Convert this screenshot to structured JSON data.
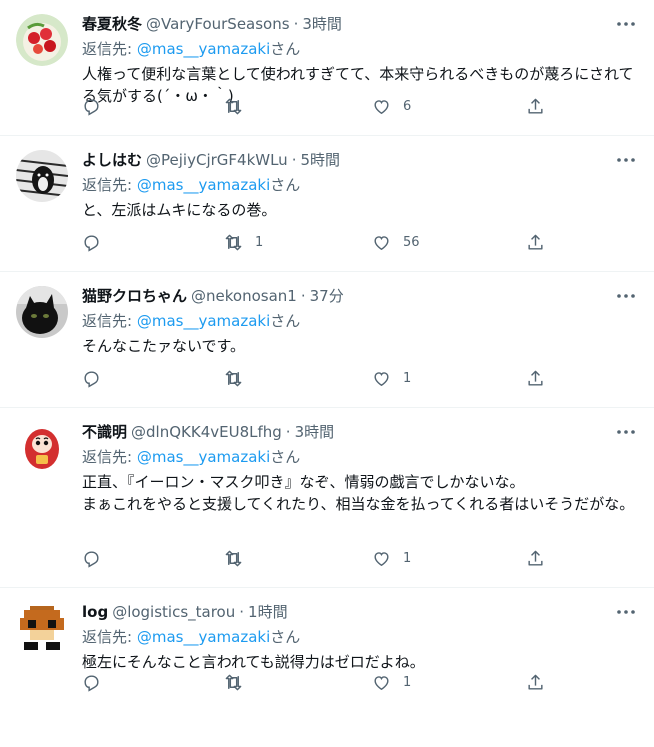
{
  "reply_prefix": "返信先: ",
  "reply_suffix": "さん",
  "separator": "·",
  "tweets": [
    {
      "name": "春夏秋冬",
      "handle": "@VaryFourSeasons",
      "time": "3時間",
      "reply_to": "@mas__yamazaki",
      "text": "人権って便利な言葉として使われすぎてて、本来守られるべきものが蔑ろにされてる気がする(´・ω・｀)",
      "replies": "",
      "retweets": "",
      "likes": "6",
      "avatar": "strawberry-dish"
    },
    {
      "name": "よしはむ",
      "handle": "@PejiyCjrGF4kWLu",
      "time": "5時間",
      "reply_to": "@mas__yamazaki",
      "text": "と、左派はムキになるの巻。",
      "replies": "",
      "retweets": "1",
      "likes": "56",
      "avatar": "dog-photo"
    },
    {
      "name": "猫野クロちゃん",
      "handle": "@nekonosan1",
      "time": "37分",
      "reply_to": "@mas__yamazaki",
      "text": "そんなこたァないです。",
      "replies": "",
      "retweets": "",
      "likes": "1",
      "avatar": "black-cat"
    },
    {
      "name": "不識明",
      "handle": "@dlnQKK4vEU8Lfhg",
      "time": "3時間",
      "reply_to": "@mas__yamazaki",
      "text": "正直、『イーロン・マスク叩き』なぞ、情弱の戯言でしかないな。\nまぁこれをやると支援してくれたり、相当な金を払ってくれる者はいそうだがな。",
      "replies": "",
      "retweets": "",
      "likes": "1",
      "avatar": "daruma"
    },
    {
      "name": "log",
      "handle": "@logistics_tarou",
      "time": "1時間",
      "reply_to": "@mas__yamazaki",
      "text": "極左にそんなこと言われても説得力はゼロだよね。",
      "replies": "",
      "retweets": "",
      "likes": "1",
      "avatar": "pixel-mushroom"
    }
  ]
}
